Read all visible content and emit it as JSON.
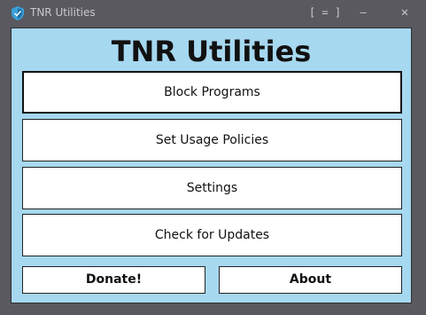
{
  "window": {
    "title": "TNR Utilities",
    "controls": {
      "menu_label": "[ = ]",
      "minimize_label": "—",
      "close_label": "✕"
    }
  },
  "main": {
    "heading": "TNR Utilities",
    "buttons": [
      {
        "label": "Block Programs"
      },
      {
        "label": "Set Usage Policies"
      },
      {
        "label": "Settings"
      },
      {
        "label": "Check for Updates"
      }
    ],
    "footer": {
      "donate_label": "Donate!",
      "about_label": "About"
    }
  },
  "colors": {
    "window_bg": "#59595f",
    "client_bg": "#a6d8f0",
    "button_bg": "#ffffff",
    "shield_icon": "#3aa0d8"
  }
}
